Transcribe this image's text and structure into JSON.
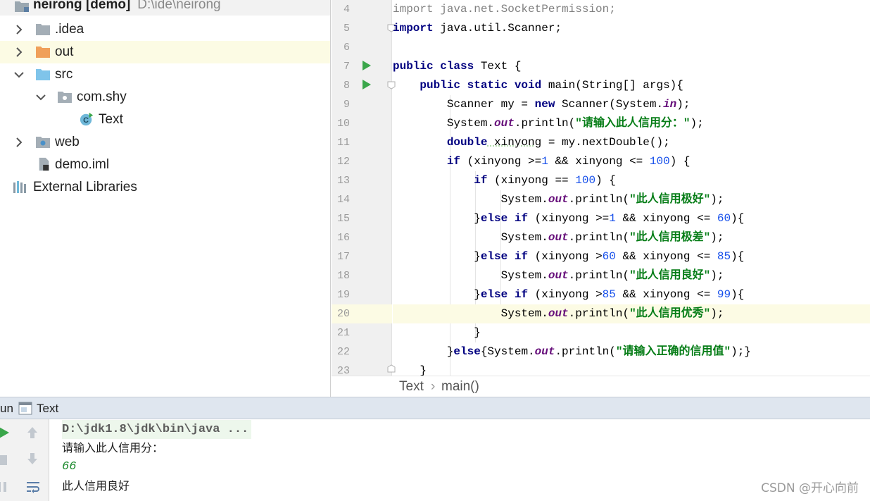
{
  "project": {
    "root": {
      "name": "neirong [demo]",
      "path": "D:\\ide\\neirong"
    },
    "items": [
      {
        "label": ".idea",
        "icon": "folder-gray-icon"
      },
      {
        "label": "out",
        "icon": "folder-orange-icon"
      },
      {
        "label": "src",
        "icon": "folder-blue-icon"
      },
      {
        "label": "com.shy",
        "icon": "package-icon"
      },
      {
        "label": "Text",
        "icon": "java-class-icon"
      },
      {
        "label": "web",
        "icon": "web-folder-icon"
      },
      {
        "label": "demo.iml",
        "icon": "iml-file-icon"
      },
      {
        "label": "External Libraries",
        "icon": "libraries-icon"
      }
    ],
    "class_icon_letter": "C"
  },
  "editor": {
    "line_numbers": [
      "4",
      "5",
      "6",
      "7",
      "8",
      "9",
      "10",
      "11",
      "12",
      "13",
      "14",
      "15",
      "16",
      "17",
      "18",
      "19",
      "20",
      "21",
      "22",
      "23"
    ],
    "current_line": "20",
    "code": {
      "l4a": "import",
      "l4b": " java.net.SocketPermission;",
      "l5a": "import",
      "l5b": " java.util.Scanner;",
      "l7a": "public class",
      "l7b": " Text {",
      "l8a": "public static void",
      "l8b": " main(String[] args){",
      "l9a": "Scanner my = ",
      "l9b": "new",
      "l9c": " Scanner(System.",
      "l9d": "in",
      "l9e": ");",
      "l10a": "System.",
      "l10b": "out",
      "l10c": ".println(",
      "l10d": "\"请输入此人信用分：\"",
      "l10e": ");",
      "l11a": "double",
      "l11b": " xinyong",
      "l11c": " = my.nextDouble();",
      "l12a": "if",
      "l12b": " (xinyong >=",
      "l12c": "1",
      "l12d": " && xinyong <= ",
      "l12e": "100",
      "l12f": ") {",
      "l13a": "if",
      "l13b": " (xinyong == ",
      "l13c": "100",
      "l13d": ") {",
      "l14a": "System.",
      "l14b": "out",
      "l14c": ".println(",
      "l14d": "\"此人信用极好\"",
      "l14e": ");",
      "l15a": "}",
      "l15b": "else if",
      "l15c": " (xinyong >=",
      "l15d": "1",
      "l15e": " && xinyong <= ",
      "l15f": "60",
      "l15g": "){",
      "l16a": "System.",
      "l16b": "out",
      "l16c": ".println(",
      "l16d": "\"此人信用极差\"",
      "l16e": ");",
      "l17a": "}",
      "l17b": "else if",
      "l17c": " (xinyong >",
      "l17d": "60",
      "l17e": " && xinyong <= ",
      "l17f": "85",
      "l17g": "){",
      "l18a": "System.",
      "l18b": "out",
      "l18c": ".println(",
      "l18d": "\"此人信用良好\"",
      "l18e": ");",
      "l19a": "}",
      "l19b": "else if",
      "l19c": " (xinyong >",
      "l19d": "85",
      "l19e": " && xinyong <= ",
      "l19f": "99",
      "l19g": "){",
      "l20a": "System.",
      "l20b": "out",
      "l20c": ".println(",
      "l20d": "\"此人信用优秀\"",
      "l20e": ");",
      "l21a": "}",
      "l22a": "}",
      "l22b": "else",
      "l22c": "{System.",
      "l22d": "out",
      "l22e": ".println(",
      "l22f": "\"请输入正确的信用值\"",
      "l22g": ");}",
      "l23a": "}"
    },
    "breadcrumb": {
      "class": "Text",
      "sep": "›",
      "method": "main()"
    }
  },
  "run": {
    "tab_prefix": "un",
    "tab_label": "Text",
    "console": [
      "D:\\jdk1.8\\jdk\\bin\\java ...",
      "请输入此人信用分：",
      "66",
      "此人信用良好"
    ]
  },
  "watermark": "CSDN @开心向前",
  "colors": {
    "keyword": "#000080",
    "number": "#1750eb",
    "string": "#067d17",
    "static_field": "#660e7a",
    "current_line": "#fcfbe4",
    "run_green": "#3aa64a"
  }
}
